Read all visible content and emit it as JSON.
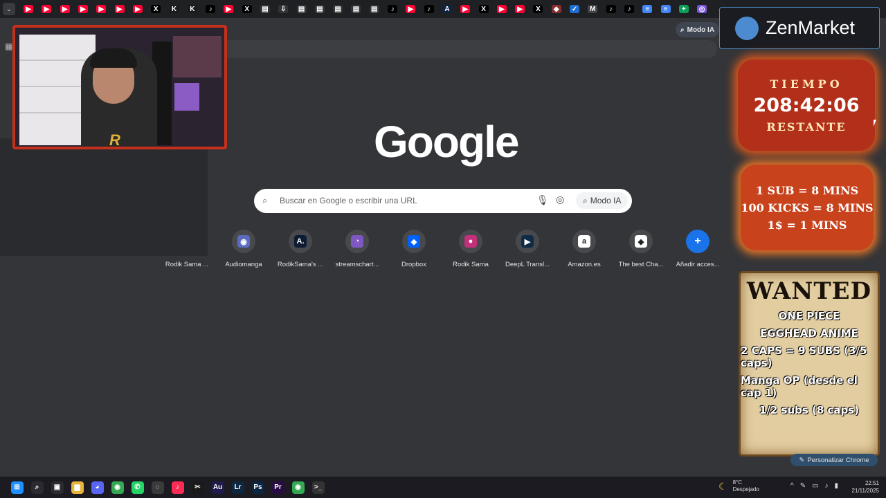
{
  "browser": {
    "tabs": [
      {
        "icon": "youtube-icon",
        "glyph": "▶",
        "color": "#ff0033"
      },
      {
        "icon": "youtube-icon",
        "glyph": "▶",
        "color": "#ff0033"
      },
      {
        "icon": "youtube-icon",
        "glyph": "▶",
        "color": "#ff0033"
      },
      {
        "icon": "youtube-icon",
        "glyph": "▶",
        "color": "#ff0033"
      },
      {
        "icon": "youtube-icon",
        "glyph": "▶",
        "color": "#ff0033"
      },
      {
        "icon": "youtube-icon",
        "glyph": "▶",
        "color": "#ff0033"
      },
      {
        "icon": "youtube-icon",
        "glyph": "▶",
        "color": "#ff0033"
      },
      {
        "icon": "x-icon",
        "glyph": "X",
        "color": "#000000"
      },
      {
        "icon": "kick-icon",
        "glyph": "K",
        "color": "#1b1b1b"
      },
      {
        "icon": "kick-icon",
        "glyph": "K",
        "color": "#1b1b1b"
      },
      {
        "icon": "tiktok-icon",
        "glyph": "♪",
        "color": "#000000"
      },
      {
        "icon": "youtube-icon",
        "glyph": "▶",
        "color": "#ff0033"
      },
      {
        "icon": "x-icon",
        "glyph": "X",
        "color": "#000000"
      },
      {
        "icon": "streamcharts-icon",
        "glyph": "▤",
        "color": "#333333"
      },
      {
        "icon": "download-icon",
        "glyph": "⇩",
        "color": "#333333"
      },
      {
        "icon": "streamcharts-icon",
        "glyph": "▤",
        "color": "#333333"
      },
      {
        "icon": "streamcharts-icon",
        "glyph": "▤",
        "color": "#333333"
      },
      {
        "icon": "streamcharts-icon",
        "glyph": "▤",
        "color": "#333333"
      },
      {
        "icon": "streamcharts-icon",
        "glyph": "▤",
        "color": "#333333"
      },
      {
        "icon": "streamcharts-icon",
        "glyph": "▤",
        "color": "#333333"
      },
      {
        "icon": "tiktok-icon",
        "glyph": "♪",
        "color": "#000000"
      },
      {
        "icon": "youtube-icon",
        "glyph": "▶",
        "color": "#ff0033"
      },
      {
        "icon": "tiktok-icon",
        "glyph": "♪",
        "color": "#000000"
      },
      {
        "icon": "audiomanga-icon",
        "glyph": "A",
        "color": "#0f2240"
      },
      {
        "icon": "youtube-icon",
        "glyph": "▶",
        "color": "#ff0033"
      },
      {
        "icon": "x-icon",
        "glyph": "X",
        "color": "#000000"
      },
      {
        "icon": "youtube-icon",
        "glyph": "▶",
        "color": "#ff0033"
      },
      {
        "icon": "youtube-icon",
        "glyph": "▶",
        "color": "#ff0033"
      },
      {
        "icon": "x-icon",
        "glyph": "X",
        "color": "#000000"
      },
      {
        "icon": "shield-icon",
        "glyph": "◆",
        "color": "#8a2f2f"
      },
      {
        "icon": "check-icon",
        "glyph": "✓",
        "color": "#1c6fd1"
      },
      {
        "icon": "gmail-icon",
        "glyph": "M",
        "color": "#444444"
      },
      {
        "icon": "tiktok-icon",
        "glyph": "♪",
        "color": "#000000"
      },
      {
        "icon": "tiktok-icon",
        "glyph": "♪",
        "color": "#000000"
      },
      {
        "icon": "docs-icon",
        "glyph": "≡",
        "color": "#4285f4"
      },
      {
        "icon": "docs-icon",
        "glyph": "≡",
        "color": "#4285f4"
      },
      {
        "icon": "sheets-icon",
        "glyph": "+",
        "color": "#0f9d58"
      },
      {
        "icon": "chat-icon",
        "glyph": "◎",
        "color": "#7a55d9"
      }
    ],
    "modo_ia_top": "Modo IA"
  },
  "ntp": {
    "logo": "Google",
    "search_placeholder": "Buscar en Google o escribir una URL",
    "modo_ia": "Modo IA",
    "shortcuts": [
      {
        "label": "Rodik Sama ...",
        "icon": "instagram-icon",
        "glyph": "◎",
        "color": "#d6297c"
      },
      {
        "label": "Audiomanga",
        "icon": "audiomanga-icon",
        "glyph": "◉",
        "color": "#5c6bc0"
      },
      {
        "label": "RodikSama's ...",
        "icon": "audiomanga-a-icon",
        "glyph": "A.",
        "color": "#0d1b33"
      },
      {
        "label": "streamschart...",
        "icon": "streamscharts-icon",
        "glyph": "◔",
        "color": "#7e57c2"
      },
      {
        "label": "Dropbox",
        "icon": "dropbox-icon",
        "glyph": "◆",
        "color": "#0061fe"
      },
      {
        "label": "Rodik Sama",
        "icon": "avatar-icon",
        "glyph": "●",
        "color": "#c2307a"
      },
      {
        "label": "DeepL Transl...",
        "icon": "deepl-icon",
        "glyph": "▶",
        "color": "#0f2b46"
      },
      {
        "label": "Amazon.es",
        "icon": "amazon-icon",
        "glyph": "a",
        "color": "#ffffff"
      },
      {
        "label": "The best Cha...",
        "icon": "chess-icon",
        "glyph": "◆",
        "color": "#ffffff"
      },
      {
        "label": "Añadir acces...",
        "icon": "add-icon",
        "glyph": "+",
        "color": "#1a73e8"
      }
    ],
    "personalize": "Personalizar Chrome"
  },
  "overlays": {
    "zenmarket": "ZenMarket",
    "timer_label": "TIEMPO",
    "timer_value": "208:42:06",
    "timer_sub": "RESTANTE",
    "rates": [
      "1 SUB = 8 MINS",
      "100 KICKS = 8 MINS",
      "1$ = 1 MINS"
    ],
    "wanted_title": "WANTED",
    "wanted_lines": [
      "ONE PIECE",
      "EGGHEAD ANIME",
      "2 CAPS = 9 SUBS (3/5 caps)",
      "Manga OP (desde el cap 1)",
      "1/2 subs (8 caps)"
    ]
  },
  "taskbar": {
    "apps": [
      {
        "icon": "windows-start-icon",
        "glyph": "⊞",
        "color": "#1e90ff"
      },
      {
        "icon": "search-icon",
        "glyph": "⌕",
        "color": "#2a2a30"
      },
      {
        "icon": "task-view-icon",
        "glyph": "▣",
        "color": "#2a2a30"
      },
      {
        "icon": "folder-icon",
        "glyph": "▆",
        "color": "#e8b53a"
      },
      {
        "icon": "discord-icon",
        "glyph": "◕",
        "color": "#5865f2"
      },
      {
        "icon": "chrome-icon",
        "glyph": "◉",
        "color": "#34a853"
      },
      {
        "icon": "whatsapp-icon",
        "glyph": "✆",
        "color": "#25d366"
      },
      {
        "icon": "obs-icon",
        "glyph": "◌",
        "color": "#3a3a3a"
      },
      {
        "icon": "tiktok-live-icon",
        "glyph": "♪",
        "color": "#fe2c55"
      },
      {
        "icon": "capcut-icon",
        "glyph": "✂",
        "color": "#1a1a1a"
      },
      {
        "icon": "audition-icon",
        "glyph": "Au",
        "color": "#1f1c4b"
      },
      {
        "icon": "lightroom-icon",
        "glyph": "Lr",
        "color": "#0d2740"
      },
      {
        "icon": "photoshop-icon",
        "glyph": "Ps",
        "color": "#0a2540"
      },
      {
        "icon": "premiere-icon",
        "glyph": "Pr",
        "color": "#2a0c44"
      },
      {
        "icon": "chrome-active-icon",
        "glyph": "◉",
        "color": "#34a853"
      },
      {
        "icon": "terminal-icon",
        "glyph": ">_",
        "color": "#333333"
      }
    ],
    "weather_temp": "8°C",
    "weather_desc": "Despejado",
    "time": "22:51",
    "date": "21/11/2025",
    "tray": [
      "^",
      "✎",
      "▭",
      "♪",
      "▮"
    ]
  }
}
